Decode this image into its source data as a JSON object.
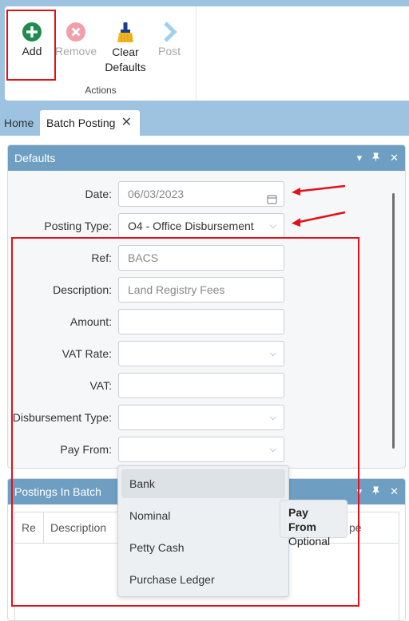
{
  "ribbon": {
    "buttons": [
      {
        "label": "Add",
        "icon": "plus-circle-icon",
        "enabled": true
      },
      {
        "label": "Remove",
        "icon": "x-circle-icon",
        "enabled": false
      },
      {
        "label": "Clear\nDefaults",
        "icon": "broom-icon",
        "enabled": true
      },
      {
        "label": "Post",
        "icon": "chevron-right-icon",
        "enabled": false
      }
    ],
    "group_caption": "Actions"
  },
  "tabs": {
    "home": "Home",
    "active": "Batch Posting",
    "close": "✕"
  },
  "defaults_panel": {
    "title": "Defaults",
    "fields": {
      "date": {
        "label": "Date:",
        "value": "06/03/2023"
      },
      "posting_type": {
        "label": "Posting Type:",
        "value": "O4 - Office Disbursement"
      },
      "ref": {
        "label": "Ref:",
        "placeholder": "BACS"
      },
      "description": {
        "label": "Description:",
        "placeholder": "Land Registry Fees"
      },
      "amount": {
        "label": "Amount:",
        "value": ""
      },
      "vat_rate": {
        "label": "VAT Rate:",
        "value": ""
      },
      "vat": {
        "label": "VAT:",
        "value": ""
      },
      "disbursement_type": {
        "label": "Disbursement Type:",
        "value": ""
      },
      "pay_from": {
        "label": "Pay From:",
        "value": ""
      }
    }
  },
  "postings_panel": {
    "title": "Postings In Batch",
    "columns": [
      "Re",
      "Description",
      "pe"
    ]
  },
  "pay_from_dropdown": {
    "options": [
      "Bank",
      "Nominal",
      "Petty Cash",
      "Purchase Ledger"
    ],
    "highlighted": "Bank"
  },
  "tooltip": {
    "title": "Pay From",
    "text": "Optional"
  },
  "colors": {
    "accent": "#6e9fc3",
    "add": "#1e8c4e",
    "remove": "#f0a0a8",
    "post": "#9fd0ef",
    "annotation": "#e3101a"
  }
}
